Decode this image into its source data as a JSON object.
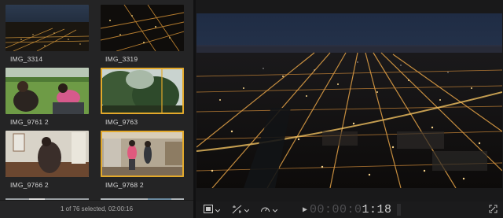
{
  "browser": {
    "clips": [
      {
        "name": "IMG_3314",
        "selected": false
      },
      {
        "name": "IMG_3319",
        "selected": false
      },
      {
        "name": "IMG_9761 2",
        "selected": false
      },
      {
        "name": "IMG_9763",
        "selected": true
      },
      {
        "name": "IMG_9766 2",
        "selected": false
      },
      {
        "name": "IMG_9768 2",
        "selected": true
      }
    ],
    "status": "1 of 76 selected, 02:00:16"
  },
  "viewer": {
    "timecode_dim": "00:00:0",
    "timecode_bright": "1:18"
  },
  "icons": {
    "display": "display-options-icon",
    "transform": "transform-icon",
    "speed": "retime-speed-icon",
    "play": "play-icon",
    "fullscreen": "fullscreen-icon"
  },
  "colors": {
    "selection": "#e3a92b",
    "panel": "#242425",
    "background": "#1e1e1f"
  }
}
